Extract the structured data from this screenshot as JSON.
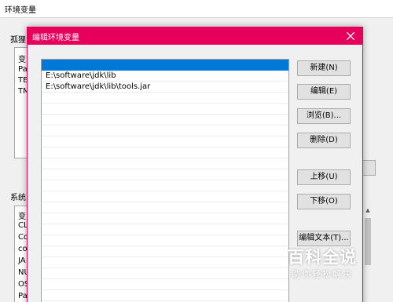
{
  "background_window": {
    "title": "环境变量",
    "user_section_label": "孤狸",
    "user_vars": [
      "变",
      "Pa",
      "TE",
      "TM"
    ],
    "system_section_label": "系统",
    "system_vars": [
      "变",
      "CL",
      "Co",
      "co",
      "JA",
      "NU",
      "OS",
      "Pa"
    ]
  },
  "dialog": {
    "title": "编辑环境变量",
    "close_icon": "close-icon",
    "paths": [
      "",
      "E:\\software\\jdk\\lib",
      "E:\\software\\jdk\\lib\\tools.jar"
    ],
    "selected_index": 0,
    "buttons": {
      "new": "新建(N)",
      "edit": "编辑(E)",
      "browse": "浏览(B)...",
      "delete": "删除(D)",
      "move_up": "上移(U)",
      "move_down": "下移(O)",
      "edit_text": "编辑文本(T)..."
    }
  },
  "watermark": {
    "logo": "百科全说",
    "tagline": "助你轻松解决"
  }
}
